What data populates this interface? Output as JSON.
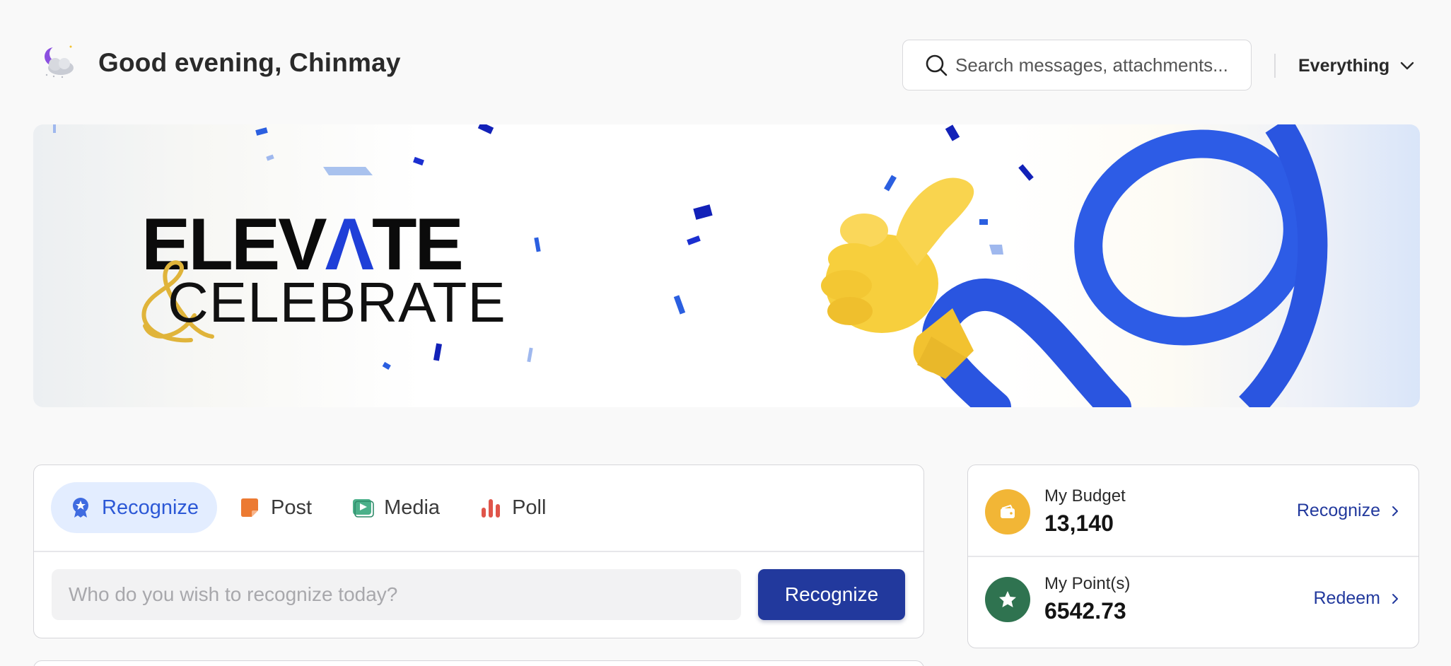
{
  "header": {
    "greeting": "Good evening, Chinmay",
    "greeting_icon": "moon-cloud-icon",
    "search_placeholder": "Search messages, attachments...",
    "scope_label": "Everything"
  },
  "banner": {
    "title_part1": "ELEV",
    "title_highlight": "Λ",
    "title_part2": "TE",
    "subtitle": "CELEBRATE",
    "ampersand": "&"
  },
  "composer": {
    "tabs": [
      {
        "label": "Recognize",
        "icon": "award-badge-icon",
        "active": true
      },
      {
        "label": "Post",
        "icon": "sticky-note-icon",
        "active": false
      },
      {
        "label": "Media",
        "icon": "video-play-icon",
        "active": false
      },
      {
        "label": "Poll",
        "icon": "bar-chart-icon",
        "active": false
      }
    ],
    "input_placeholder": "Who do you wish to recognize today?",
    "submit_label": "Recognize"
  },
  "wallet": {
    "budget": {
      "label": "My Budget",
      "value": "13,140",
      "action": "Recognize",
      "icon": "wallet-icon"
    },
    "points": {
      "label": "My Point(s)",
      "value": "6542.73",
      "action": "Redeem",
      "icon": "star-icon"
    }
  },
  "colors": {
    "accent": "#22399d",
    "active_tab_bg": "#e3edff",
    "active_tab_text": "#2c58d6",
    "wallet": "#f2b636",
    "points": "#2f7350"
  }
}
